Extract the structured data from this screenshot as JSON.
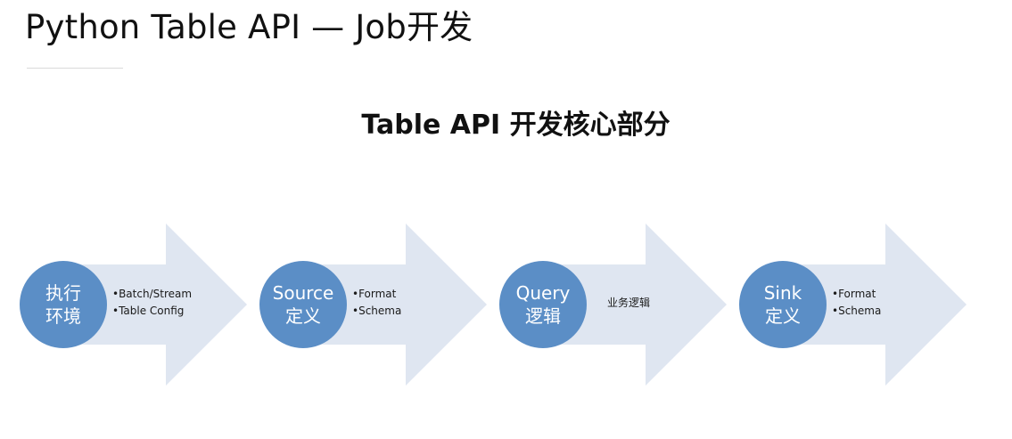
{
  "slide": {
    "title": "Python Table API — Job开发",
    "heading": "Table API 开发核心部分"
  },
  "colors": {
    "circle_fill": "#5b8ec6",
    "arrow_fill": "#dfe6f1"
  },
  "steps": [
    {
      "circle_lines": [
        "执行",
        "环境"
      ],
      "bullets": [
        "Batch/Stream",
        "Table Config"
      ]
    },
    {
      "circle_lines": [
        "Source",
        "定义"
      ],
      "bullets": [
        "Format",
        "Schema"
      ]
    },
    {
      "circle_lines": [
        "Query",
        "逻辑"
      ],
      "text": "业务逻辑"
    },
    {
      "circle_lines": [
        "Sink",
        "定义"
      ],
      "bullets": [
        "Format",
        "Schema"
      ]
    }
  ]
}
